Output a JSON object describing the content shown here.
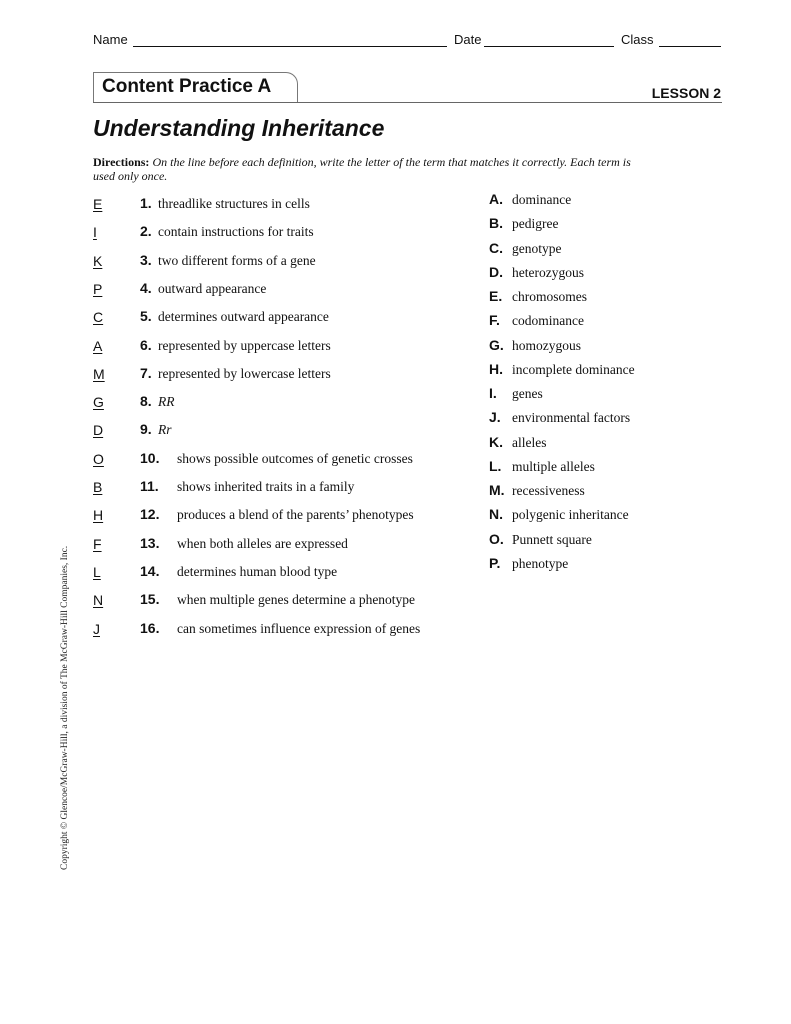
{
  "header": {
    "name_label": "Name",
    "date_label": "Date",
    "class_label": "Class"
  },
  "section": {
    "tab_title": "Content Practice A",
    "lesson": "LESSON 2"
  },
  "title": "Understanding Inheritance",
  "directions": {
    "label": "Directions:",
    "text": "On the line before each definition, write the letter of the term that matches it correctly. Each term is used only once."
  },
  "questions": [
    {
      "answer": "E",
      "number": "1.",
      "text": "threadlike structures in cells"
    },
    {
      "answer": "I",
      "number": "2.",
      "text": "contain instructions for traits"
    },
    {
      "answer": "K",
      "number": "3.",
      "text": "two different forms of a gene"
    },
    {
      "answer": "P",
      "number": "4.",
      "text": "outward appearance"
    },
    {
      "answer": "C",
      "number": "5.",
      "text": "determines outward appearance"
    },
    {
      "answer": "A",
      "number": "6.",
      "text": "represented by uppercase letters"
    },
    {
      "answer": "M",
      "number": "7.",
      "text": "represented by lowercase letters"
    },
    {
      "answer": "G",
      "number": "8.",
      "text": "RR"
    },
    {
      "answer": "D",
      "number": "9.",
      "text": "Rr"
    },
    {
      "answer": "O",
      "number": "10.",
      "text": "shows possible outcomes of genetic crosses"
    },
    {
      "answer": "B",
      "number": "11.",
      "text": "shows inherited traits in a family"
    },
    {
      "answer": "H",
      "number": "12.",
      "text": "produces a blend of the parents’ phenotypes"
    },
    {
      "answer": "F",
      "number": "13.",
      "text": "when both alleles are expressed"
    },
    {
      "answer": "L",
      "number": "14.",
      "text": "determines human blood type"
    },
    {
      "answer": "N",
      "number": "15.",
      "text": "when multiple genes determine a phenotype"
    },
    {
      "answer": "J",
      "number": "16.",
      "text": "can sometimes influence expression of genes"
    }
  ],
  "terms": [
    {
      "letter": "A.",
      "term": "dominance"
    },
    {
      "letter": "B.",
      "term": "pedigree"
    },
    {
      "letter": "C.",
      "term": "genotype"
    },
    {
      "letter": "D.",
      "term": "heterozygous"
    },
    {
      "letter": "E.",
      "term": "chromosomes"
    },
    {
      "letter": "F.",
      "term": "codominance"
    },
    {
      "letter": "G.",
      "term": "homozygous"
    },
    {
      "letter": "H.",
      "term": "incomplete dominance"
    },
    {
      "letter": "I.",
      "term": "genes"
    },
    {
      "letter": "J.",
      "term": "environmental factors"
    },
    {
      "letter": "K.",
      "term": "alleles"
    },
    {
      "letter": "L.",
      "term": "multiple alleles"
    },
    {
      "letter": "M.",
      "term": "recessiveness"
    },
    {
      "letter": "N.",
      "term": "polygenic inheritance"
    },
    {
      "letter": "O.",
      "term": "Punnett square"
    },
    {
      "letter": "P.",
      "term": "phenotype"
    }
  ],
  "copyright": "Copyright © Glencoe/McGraw-Hill, a division of The McGraw-Hill Companies, Inc."
}
